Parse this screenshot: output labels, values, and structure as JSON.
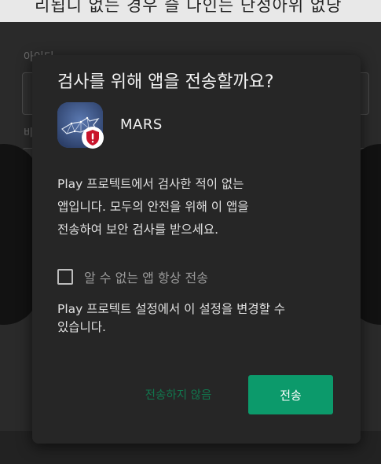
{
  "background": {
    "top_banner_text": "리됩니 없는 경우 슬 다인는 단성아위 없당",
    "id_label": "아이디",
    "password_label_partial": "비"
  },
  "dialog": {
    "title": "검사를 위해 앱을 전송할까요?",
    "app": {
      "name": "MARS",
      "icon": "mars-shark-icon",
      "badge_icon": "warning-shield-icon"
    },
    "message_lines": [
      "Play 프로텍트에서 검사한 적이 없는",
      "앱입니다. 모두의 안전을 위해 이 앱을",
      "전송하여 보안 검사를 받으세요."
    ],
    "checkbox": {
      "label": "알 수 없는 앱 항상 전송",
      "checked": false
    },
    "settings_note_lines": [
      "Play 프로텍트 설정에서 이 설정을 변경할 수",
      "있습니다."
    ],
    "buttons": {
      "cancel": "전송하지 않음",
      "send": "전송"
    }
  },
  "colors": {
    "accent": "#0c9a6b",
    "cancel_text": "#11774e",
    "dialog_bg": "#262626",
    "badge_red": "#c9142b"
  }
}
